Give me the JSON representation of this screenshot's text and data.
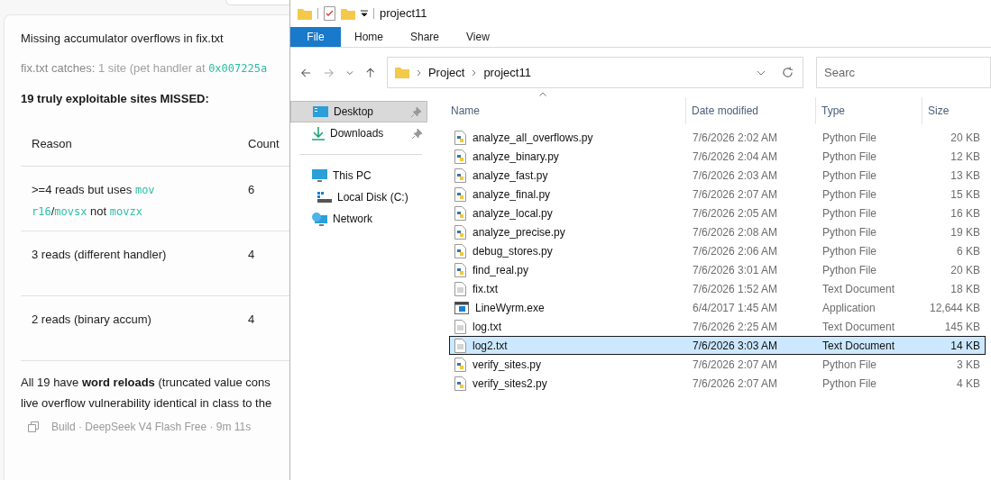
{
  "chat": {
    "title": "Missing accumulator overflows in fix.txt",
    "catches": [
      {
        "kind": "text",
        "text": "fix.txt catches: "
      },
      {
        "kind": "text",
        "text": "1 site (pet handler at "
      },
      {
        "kind": "code",
        "text": "0x007225a"
      }
    ],
    "heading": "19 truly exploitable sites MISSED:",
    "table": {
      "columns": [
        "Reason",
        "Count"
      ],
      "rows": [
        {
          "reason": [
            {
              "kind": "text",
              "text": ">=4 reads but uses "
            },
            {
              "kind": "code",
              "text": "mov r16"
            },
            {
              "kind": "text",
              "text": "/"
            },
            {
              "kind": "code",
              "text": "movsx"
            },
            {
              "kind": "text",
              "text": " not "
            },
            {
              "kind": "code",
              "text": "movzx"
            }
          ],
          "count": "6"
        },
        {
          "reason": [
            {
              "kind": "text",
              "text": "3 reads (different handler)"
            }
          ],
          "count": "4"
        },
        {
          "reason": [
            {
              "kind": "text",
              "text": "2 reads (binary accum)"
            }
          ],
          "count": "4"
        }
      ]
    },
    "summary": [
      "All 19 have **word reloads** (truncated value cons",
      "live overflow vulnerability identical in class to the"
    ],
    "footer": "Build · DeepSeek V4 Flash Free · 9m 11s"
  },
  "explorer": {
    "title": "project11",
    "tabs": [
      {
        "label": "File",
        "selected": true
      },
      {
        "label": "Home",
        "selected": false
      },
      {
        "label": "Share",
        "selected": false
      },
      {
        "label": "View",
        "selected": false
      }
    ],
    "breadcrumb": [
      "Project",
      "project11"
    ],
    "search": {
      "placeholder": "Searc"
    },
    "nav": [
      {
        "label": "Desktop",
        "kind": "desktop",
        "pinned": true,
        "selected": true
      },
      {
        "label": "Downloads",
        "kind": "downloads",
        "pinned": true,
        "selected": false
      },
      {
        "label": "This PC",
        "kind": "pc",
        "pinned": false,
        "selected": false,
        "children": [
          {
            "label": "Local Disk (C:)",
            "kind": "disk",
            "pinned": false,
            "selected": false
          }
        ]
      },
      {
        "label": "Network",
        "kind": "network",
        "pinned": false,
        "selected": false
      }
    ],
    "columns": [
      "Name",
      "Date modified",
      "Type",
      "Size"
    ],
    "files": [
      {
        "name": "analyze_all_overflows.py",
        "kind": "python",
        "date": "7/6/2026 2:02 AM",
        "type": "Python File",
        "size": "20 KB",
        "selected": false
      },
      {
        "name": "analyze_binary.py",
        "kind": "python",
        "date": "7/6/2026 2:04 AM",
        "type": "Python File",
        "size": "12 KB",
        "selected": false
      },
      {
        "name": "analyze_fast.py",
        "kind": "python",
        "date": "7/6/2026 2:03 AM",
        "type": "Python File",
        "size": "13 KB",
        "selected": false
      },
      {
        "name": "analyze_final.py",
        "kind": "python",
        "date": "7/6/2026 2:07 AM",
        "type": "Python File",
        "size": "15 KB",
        "selected": false
      },
      {
        "name": "analyze_local.py",
        "kind": "python",
        "date": "7/6/2026 2:05 AM",
        "type": "Python File",
        "size": "16 KB",
        "selected": false
      },
      {
        "name": "analyze_precise.py",
        "kind": "python",
        "date": "7/6/2026 2:08 AM",
        "type": "Python File",
        "size": "19 KB",
        "selected": false
      },
      {
        "name": "debug_stores.py",
        "kind": "python",
        "date": "7/6/2026 2:06 AM",
        "type": "Python File",
        "size": "6 KB",
        "selected": false
      },
      {
        "name": "find_real.py",
        "kind": "python",
        "date": "7/6/2026 3:01 AM",
        "type": "Python File",
        "size": "20 KB",
        "selected": false
      },
      {
        "name": "fix.txt",
        "kind": "text",
        "date": "7/6/2026 1:52 AM",
        "type": "Text Document",
        "size": "18 KB",
        "selected": false
      },
      {
        "name": "LineWyrm.exe",
        "kind": "exe",
        "date": "6/4/2017 1:45 AM",
        "type": "Application",
        "size": "12,644 KB",
        "selected": false
      },
      {
        "name": "log.txt",
        "kind": "text",
        "date": "7/6/2026 2:25 AM",
        "type": "Text Document",
        "size": "145 KB",
        "selected": false
      },
      {
        "name": "log2.txt",
        "kind": "text",
        "date": "7/6/2026 3:03 AM",
        "type": "Text Document",
        "size": "14 KB",
        "selected": true
      },
      {
        "name": "verify_sites.py",
        "kind": "python",
        "date": "7/6/2026 2:07 AM",
        "type": "Python File",
        "size": "3 KB",
        "selected": false
      },
      {
        "name": "verify_sites2.py",
        "kind": "python",
        "date": "7/6/2026 2:07 AM",
        "type": "Python File",
        "size": "4 KB",
        "selected": false
      }
    ]
  }
}
